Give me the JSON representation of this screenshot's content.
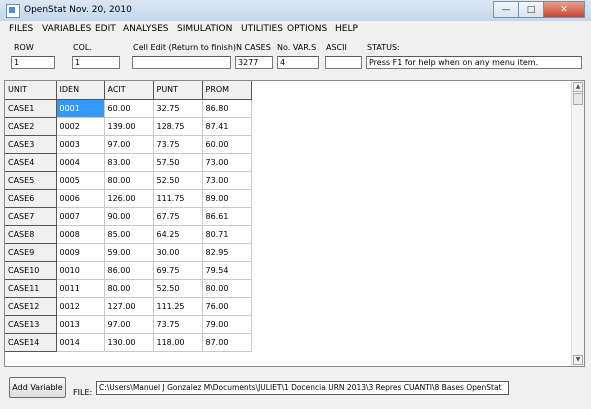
{
  "window": {
    "title": "OpenStat Nov. 20, 2010"
  },
  "menu": [
    "FILES",
    "VARIABLES",
    "EDIT",
    "ANALYSES",
    "SIMULATION",
    "UTILITIES",
    "OPTIONS",
    "HELP"
  ],
  "fields": {
    "row": {
      "label": "ROW",
      "value": "1"
    },
    "col": {
      "label": "COL.",
      "value": "1"
    },
    "cell_edit": {
      "label": "Cell Edit (Return to finish)",
      "value": ""
    },
    "n_cases": {
      "label": "N CASES",
      "value": "3277"
    },
    "no_vars": {
      "label": "No. VAR.S",
      "value": "4"
    },
    "ascii": {
      "label": "ASCII",
      "value": ""
    },
    "status": {
      "label": "STATUS:",
      "value": "Press F1 for help when on any menu item."
    }
  },
  "grid": {
    "headers": [
      "UNIT",
      "IDEN",
      "ACIT",
      "PUNT",
      "PROM"
    ],
    "rows": [
      [
        "CASE1",
        "0001",
        "60.00",
        "32.75",
        "86.80"
      ],
      [
        "CASE2",
        "0002",
        "139.00",
        "128.75",
        "87.41"
      ],
      [
        "CASE3",
        "0003",
        "97.00",
        "73.75",
        "60.00"
      ],
      [
        "CASE4",
        "0004",
        "83.00",
        "57.50",
        "73.00"
      ],
      [
        "CASE5",
        "0005",
        "80.00",
        "52.50",
        "73.00"
      ],
      [
        "CASE6",
        "0006",
        "126.00",
        "111.75",
        "89.00"
      ],
      [
        "CASE7",
        "0007",
        "90.00",
        "67.75",
        "86.61"
      ],
      [
        "CASE8",
        "0008",
        "85.00",
        "64.25",
        "80.71"
      ],
      [
        "CASE9",
        "0009",
        "59.00",
        "30.00",
        "82.95"
      ],
      [
        "CASE10",
        "0010",
        "86.00",
        "69.75",
        "79.54"
      ],
      [
        "CASE11",
        "0011",
        "80.00",
        "52.50",
        "80.00"
      ],
      [
        "CASE12",
        "0012",
        "127.00",
        "111.25",
        "76.00"
      ],
      [
        "CASE13",
        "0013",
        "97.00",
        "73.75",
        "79.00"
      ],
      [
        "CASE14",
        "0014",
        "130.00",
        "118.00",
        "87.00"
      ]
    ]
  },
  "bottom": {
    "add_variable": "Add Variable",
    "file_label": "FILE:",
    "file_path": "C:\\Users\\Manuel J Gonzalez M\\Documents\\JULIET\\1 Docencia URN 2013\\3 Repres CUANTI\\8 Bases OpenStat"
  }
}
